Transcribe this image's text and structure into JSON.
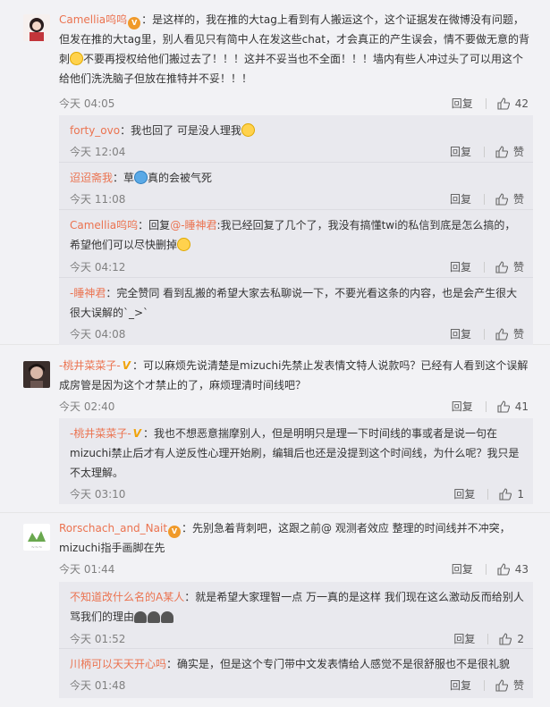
{
  "comments": [
    {
      "user": "Camellia呜呜",
      "text_a": "：是这样的，我在推的大tag上看到有人搬运这个，这个证据发在微博没有问题，但发在推的大tag里，别人看见只有简中人在发这些chat，才会真正的产生误会，情不要做无意的背刺",
      "text_b": "不要再授权给他们搬过去了！！！这并不妥当也不全面！！！墙内有些人冲过头了可以用这个给他们洗洗脑子但放在推特并不妥！！！",
      "time": "今天 04:05",
      "reply_label": "回复",
      "likes": "42",
      "replies": [
        {
          "user": "forty_ovo",
          "text": "：我也回了 可是没人理我",
          "time": "今天 12:04",
          "reply_label": "回复",
          "likes": "赞"
        },
        {
          "user": "迢迢斋我",
          "text_a": "：草",
          "text_b": "真的会被气死",
          "time": "今天 11:08",
          "reply_label": "回复",
          "likes": "赞"
        },
        {
          "user": "Camellia呜呜",
          "prefix": "：回复",
          "mention": "@-睡神君",
          "text": ":我已经回复了几个了，我没有搞懂twi的私信到底是怎么搞的，希望他们可以尽快删掉",
          "time": "今天 04:12",
          "reply_label": "回复",
          "likes": "赞"
        },
        {
          "user": "-睡神君",
          "text": "：完全赞同 看到乱搬的希望大家去私聊说一下，不要光看这条的内容，也是会产生很大很大误解的`_>`",
          "time": "今天 04:08",
          "reply_label": "回复",
          "likes": "赞"
        }
      ]
    },
    {
      "user": "-桃井菜菜子-",
      "text": "：可以麻烦先说清楚是mizuchi先禁止发表情文特人说款吗？已经有人看到这个误解成房管是因为这个才禁止的了，麻烦理清时间线吧？",
      "time": "今天 02:40",
      "reply_label": "回复",
      "likes": "41",
      "replies": [
        {
          "user": "-桃井菜菜子-",
          "text": "：我也不想恶意揣摩别人，但是明明只是理一下时间线的事或者是说一句在mizuchi禁止后才有人逆反性心理开始刷，编辑后也还是没提到这个时间线，为什么呢？我只是不太理解。",
          "time": "今天 03:10",
          "reply_label": "回复",
          "likes": "1"
        }
      ]
    },
    {
      "user": "Rorschach_and_Nait",
      "text": "：先别急着背刺吧，这跟之前@ 观测者效应 整理的时间线并不冲突，mizuchi指手画脚在先",
      "time": "今天 01:44",
      "reply_label": "回复",
      "likes": "43",
      "replies": [
        {
          "user": "不知道改什么名的A某人",
          "text": "：就是希望大家理智一点 万一真的是这样 我们现在这么激动反而给别人骂我们的理由",
          "time": "今天 01:52",
          "reply_label": "回复",
          "likes": "2"
        },
        {
          "user": "川柄可以天天开心吗",
          "text": "：确实是，但是这个专门带中文发表情给人感觉不是很舒服也不是很礼貌",
          "time": "今天 01:48",
          "reply_label": "回复",
          "likes": "赞"
        }
      ]
    }
  ],
  "colors": {
    "username": "#eb7350",
    "mention": "#eb7350",
    "text": "#333333",
    "time": "#808080",
    "reply_bg": "#e9e9ee",
    "page_bg": "#f2f2f5"
  }
}
